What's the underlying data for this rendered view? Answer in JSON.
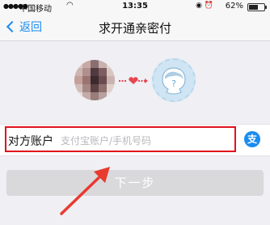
{
  "status_bar": {
    "carrier": "中国移动",
    "time": "13:35",
    "battery": "62%",
    "battery_level": 0.62
  },
  "nav": {
    "back_label": "返回",
    "title": "求开通亲密付"
  },
  "form": {
    "account_label": "对方账户",
    "account_placeholder": "支付宝账户/手机号码",
    "account_value": "",
    "alipay_glyph": "支"
  },
  "next_button": {
    "label": "下一步"
  },
  "colors": {
    "accent": "#1a8cf0",
    "highlight": "#e0121c",
    "heart": "#e8454f",
    "button_disabled": "#d9d9dc"
  }
}
